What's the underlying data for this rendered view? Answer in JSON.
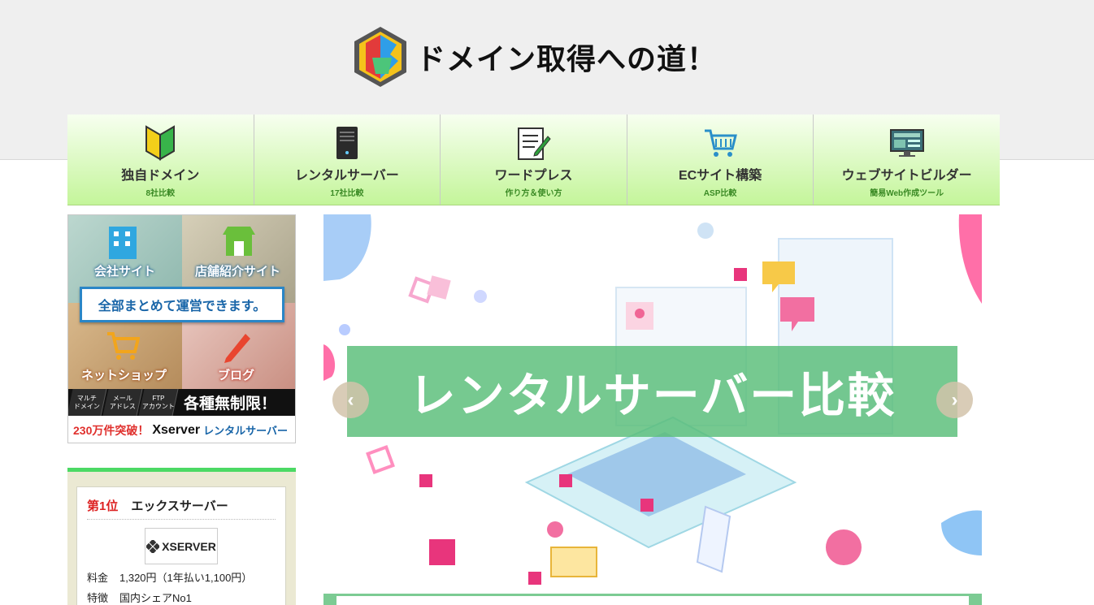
{
  "header": {
    "site_title": "ドメイン取得への道！"
  },
  "nav": {
    "items": [
      {
        "label": "独自ドメイン",
        "sub": "8社比較",
        "icon": "beginner-mark-icon"
      },
      {
        "label": "レンタルサーバー",
        "sub": "17社比較",
        "icon": "server-tower-icon"
      },
      {
        "label": "ワードプレス",
        "sub": "作り方＆使い方",
        "icon": "document-pen-icon"
      },
      {
        "label": "ECサイト構築",
        "sub": "ASP比較",
        "icon": "shopping-cart-icon"
      },
      {
        "label": "ウェブサイトビルダー",
        "sub": "簡易Web作成ツール",
        "icon": "monitor-icon"
      }
    ]
  },
  "ad": {
    "label_company": "会社サイト",
    "label_shop": "店舗紹介サイト",
    "banner": "全部まとめて運営できます。",
    "label_netshop": "ネットショップ",
    "label_blog": "ブログ",
    "chips": [
      "マルチ\nドメイン",
      "メール\nアドレス",
      "FTP\nアカウント"
    ],
    "unlimited": "各種無制限！",
    "count": "230万件突破！",
    "brand": "Xserver",
    "product": "レンタルサーバー"
  },
  "ranking": {
    "rank": "第1位",
    "name": "エックスサーバー",
    "logo_text": "XSERVER",
    "rows": [
      {
        "key": "料金",
        "value": "1,320円（1年払い1,100円）"
      },
      {
        "key": "特徴",
        "value": "国内シェアNo1"
      }
    ]
  },
  "slider": {
    "caption": "レンタルサーバー比較",
    "prev": "‹",
    "next": "›"
  },
  "colors": {
    "nav_gradient_top": "#f7fff0",
    "nav_gradient_bottom": "#c4f59a",
    "caption_green": "#58bd78",
    "rank_accent": "#4cd964",
    "rank_red": "#dd2222"
  }
}
